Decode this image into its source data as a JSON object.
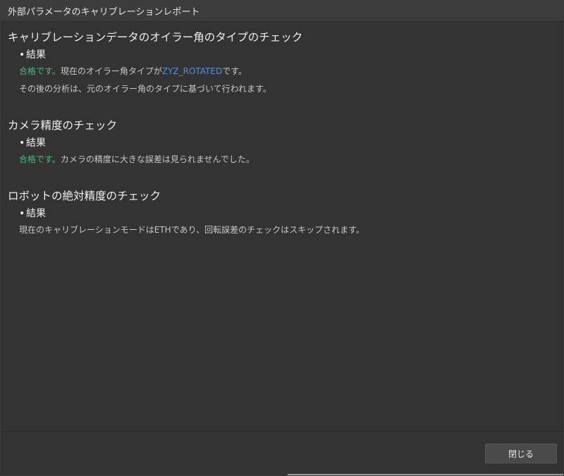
{
  "window": {
    "title": "外部パラメータのキャリブレーションレポート"
  },
  "sections": [
    {
      "title": "キャリブレーションデータのオイラー角のタイプのチェック",
      "bullet": "結果",
      "line1_pass": "合格です。",
      "line1_text_a": "現在のオイラー角タイプが",
      "line1_value": "ZYZ_ROTATED",
      "line1_text_b": "です。",
      "line2": "その後の分析は、元のオイラー角のタイプに基づいて行われます。"
    },
    {
      "title": "カメラ精度のチェック",
      "bullet": "結果",
      "line1_pass": "合格です。",
      "line1_text": "カメラの精度に大きな誤差は見られませんでした。"
    },
    {
      "title": "ロボットの絶対精度のチェック",
      "bullet": "結果",
      "line1_text": "現在のキャリブレーションモードはETHであり、回転誤差のチェックはスキップされます。"
    }
  ],
  "footer": {
    "close_label": "閉じる"
  },
  "colors": {
    "pass": "#4cb87a",
    "value": "#5b8fd6",
    "background": "#333333"
  }
}
